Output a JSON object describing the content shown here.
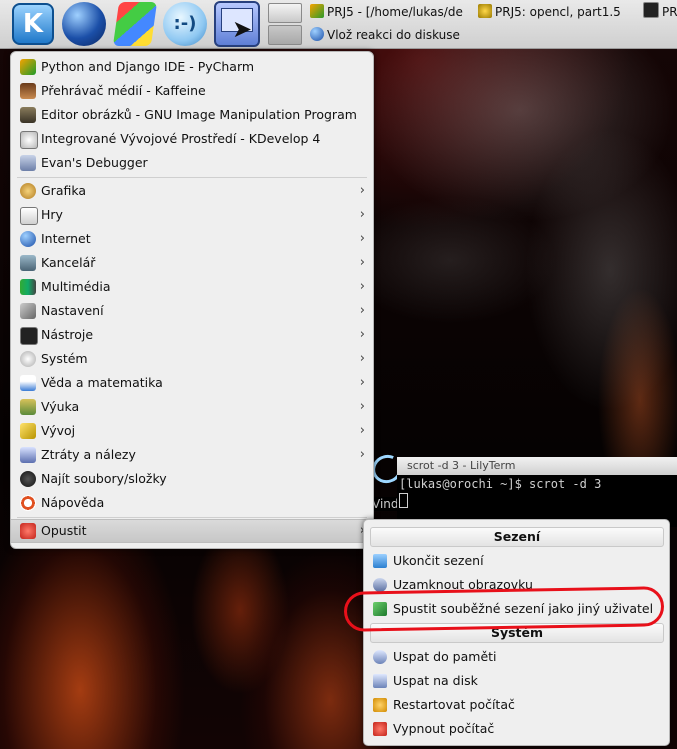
{
  "taskbar": {
    "launchers": [
      {
        "icon": "kde-kmenu-icon"
      },
      {
        "icon": "firefox-globe-icon"
      },
      {
        "icon": "windows-logo-icon"
      },
      {
        "icon": "chat-bubble-icon"
      },
      {
        "icon": "pointer-screen-icon"
      }
    ],
    "k_letter": "K",
    "chat_glyph": ":-)",
    "tasks": [
      {
        "label": "PRJ5 - [/home/lukas/de",
        "icon": "pycharm-icon"
      },
      {
        "label": "PRJ5:  opencl, part1.5",
        "icon": "kdevelop-icon"
      },
      {
        "label": "PRJ",
        "icon": "terminal-icon"
      },
      {
        "label": "Vlož reakci do diskuse",
        "icon": "firefox-globe-icon"
      }
    ]
  },
  "menu": {
    "favorites": [
      {
        "label": "Python and Django IDE - PyCharm",
        "icon": "pycharm-icon"
      },
      {
        "label": "Přehrávač médií - Kaffeine",
        "icon": "kaffeine-icon"
      },
      {
        "label": "Editor obrázků - GNU Image Manipulation Program",
        "icon": "gimp-icon"
      },
      {
        "label": "Integrované Vývojové Prostředí - KDevelop 4",
        "icon": "kdevelop-icon"
      },
      {
        "label": "Evan's Debugger",
        "icon": "debugger-icon"
      }
    ],
    "categories": [
      {
        "label": "Grafika",
        "icon": "graphics-icon"
      },
      {
        "label": "Hry",
        "icon": "games-icon"
      },
      {
        "label": "Internet",
        "icon": "internet-icon"
      },
      {
        "label": "Kancelář",
        "icon": "office-icon"
      },
      {
        "label": "Multimédia",
        "icon": "multimedia-icon"
      },
      {
        "label": "Nastavení",
        "icon": "settings-icon"
      },
      {
        "label": "Nástroje",
        "icon": "tools-icon"
      },
      {
        "label": "Systém",
        "icon": "system-icon"
      },
      {
        "label": "Věda a matematika",
        "icon": "science-icon"
      },
      {
        "label": "Výuka",
        "icon": "education-icon"
      },
      {
        "label": "Vývoj",
        "icon": "development-icon"
      },
      {
        "label": "Ztráty a nálezy",
        "icon": "lost-found-icon"
      }
    ],
    "find": {
      "label": "Najít soubory/složky",
      "icon": "binoculars-icon"
    },
    "help": {
      "label": "Nápověda",
      "icon": "help-icon"
    },
    "quit": {
      "label": "Opustit",
      "icon": "quit-icon"
    },
    "arrow": "›"
  },
  "terminal": {
    "title": "scrot -d 3 - LilyTerm",
    "prompt_line": "[lukas@orochi ~]$ scrot -d 3",
    "behind_text": "Vindo"
  },
  "submenu": {
    "session_header": "Sezení",
    "session_items": [
      {
        "label": "Ukončit sezení",
        "icon": "logout-icon"
      },
      {
        "label": "Uzamknout obrazovku",
        "icon": "lock-screen-icon"
      },
      {
        "label": "Spustit souběžné sezení jako jiný uživatel",
        "icon": "switch-user-icon"
      }
    ],
    "system_header": "Systém",
    "system_items": [
      {
        "label": "Uspat do paměti",
        "icon": "suspend-ram-icon"
      },
      {
        "label": "Uspat na disk",
        "icon": "hibernate-icon"
      },
      {
        "label": "Restartovat počítač",
        "icon": "restart-icon"
      },
      {
        "label": "Vypnout počítač",
        "icon": "shutdown-icon"
      }
    ]
  },
  "colors": {
    "highlight_circle": "#e8101a",
    "menu_bg": "#efefef"
  }
}
